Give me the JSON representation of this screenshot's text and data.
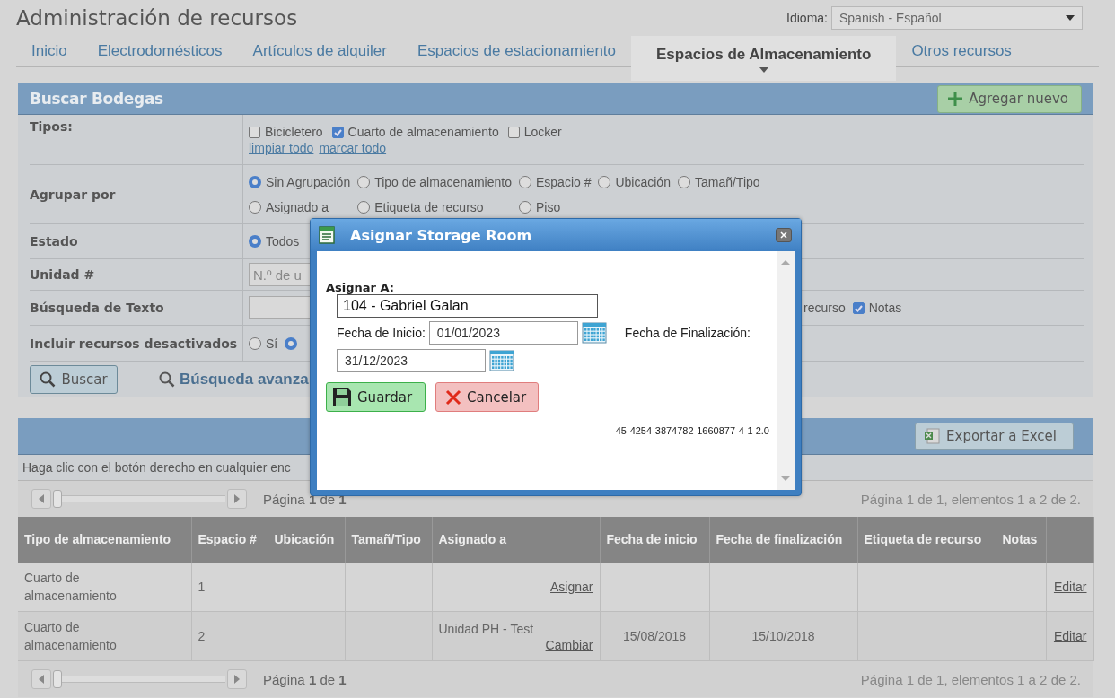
{
  "header": {
    "title": "Administración de recursos",
    "language_label": "Idioma:",
    "language_value": "Spanish - Español"
  },
  "tabs": [
    {
      "label": "Inicio",
      "selected": false
    },
    {
      "label": "Electrodomésticos",
      "selected": false
    },
    {
      "label": "Artículos de alquiler",
      "selected": false
    },
    {
      "label": "Espacios de estacionamiento",
      "selected": false
    },
    {
      "label": "Espacios de Almacenamiento",
      "selected": true
    },
    {
      "label": "Otros recursos",
      "selected": false
    }
  ],
  "search_panel": {
    "title": "Buscar Bodegas",
    "add_button": "Agregar nuevo",
    "rows": [
      {
        "label": "Tipos:",
        "kind": "checkboxes",
        "options": [
          {
            "label": "Bicicletero",
            "checked": false
          },
          {
            "label": "Cuarto de almacenamiento",
            "checked": true
          },
          {
            "label": "Locker",
            "checked": false
          }
        ],
        "links": [
          "limpiar todo",
          "marcar todo"
        ]
      },
      {
        "label": "Agrupar por",
        "kind": "radios",
        "options": [
          {
            "label": "Sin Agrupación",
            "selected": true
          },
          {
            "label": "Tipo de almacenamiento",
            "selected": false
          },
          {
            "label": "Espacio #",
            "selected": false
          },
          {
            "label": "Ubicación",
            "selected": false
          },
          {
            "label": "Tamañ/Tipo",
            "selected": false
          },
          {
            "label": "Asignado a",
            "selected": false
          },
          {
            "label": "Etiqueta de recurso",
            "selected": false
          },
          {
            "label": "Piso",
            "selected": false
          }
        ]
      },
      {
        "label": "Estado",
        "kind": "radios",
        "options": [
          {
            "label": "Todos",
            "selected": true
          }
        ]
      },
      {
        "label": "Unidad #",
        "kind": "input",
        "placeholder": "N.º de u"
      },
      {
        "label": "Búsqueda de Texto",
        "kind": "text_search",
        "options": [
          {
            "label": "recurso",
            "kind": "label_only"
          },
          {
            "label": "Notas",
            "kind": "checkbox",
            "checked": true
          }
        ]
      },
      {
        "label": "Incluir recursos desactivados",
        "kind": "radios",
        "options": [
          {
            "label": "Sí",
            "selected": false
          },
          {
            "selected": true
          }
        ]
      }
    ],
    "search_button": "Buscar",
    "advanced_search": "Búsqueda avanza"
  },
  "results": {
    "export_button": "Exportar a Excel",
    "hint": "Haga clic con el botón derecho en cualquier enc",
    "pagers": [
      {
        "page_text": "Página **1** de **1**",
        "summary": "Página 1 de 1, elementos 1 a 2 de 2.",
        "level": 0
      },
      {
        "page_text": "Página **1** de **1**",
        "summary": "Página 1 de 1, elementos 1 a 2 de 2.",
        "level": 0
      }
    ],
    "columns": [
      "Tipo de almacenamiento",
      "Espacio #",
      "Ubicación",
      "Tamañ/Tipo",
      "Asignado a",
      "Fecha de inicio",
      "Fecha de finalización",
      "Etiqueta de recurso",
      "Notas"
    ],
    "rows": [
      {
        "cells": [
          {
            "text": "Cuarto de almacenamiento"
          },
          {
            "text": "1"
          },
          {},
          {},
          {
            "link": "Asignar"
          },
          {},
          {},
          {},
          {},
          {
            "link": "Editar"
          }
        ]
      },
      {
        "cells": [
          {
            "text": "Cuarto de almacenamiento"
          },
          {
            "text": "2"
          },
          {},
          {},
          {
            "text": "Unidad PH - Test",
            "link": "Cambiar"
          },
          {
            "text": "15/08/2018"
          },
          {
            "text": "15/10/2018"
          },
          {},
          {},
          {
            "link": "Editar"
          }
        ]
      }
    ]
  },
  "modal": {
    "title": "Asignar Storage Room",
    "assign_label": "Asignar A:",
    "assign_value": "104 - Gabriel Galan",
    "start_label": "Fecha de Inicio:",
    "start_value": "01/01/2023",
    "end_label": "Fecha de Finalización:",
    "end_value": "31/12/2023",
    "save_button": "Guardar",
    "cancel_button": "Cancelar",
    "code": "45-4254-3874782-1660877-4-1 2.0"
  }
}
